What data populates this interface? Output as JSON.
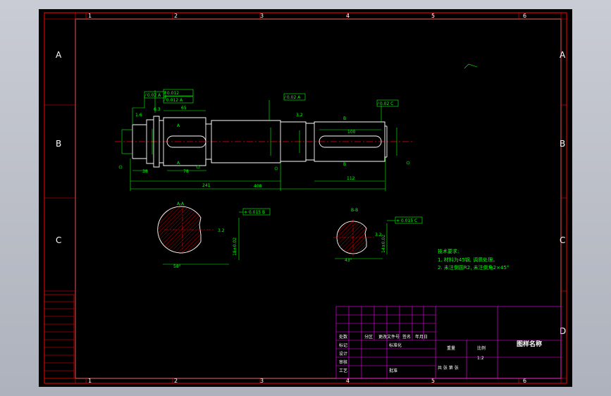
{
  "colors": {
    "background": "#000000",
    "frame": "#ff0000",
    "outline": "#ffffff",
    "dimension": "#00ff00",
    "centerline": "#ff0000",
    "table": "#ff00ff",
    "viewport": "#b8bcc6"
  },
  "zones": {
    "columns": [
      "1",
      "2",
      "3",
      "4",
      "5",
      "6"
    ],
    "rows": [
      "A",
      "B",
      "C",
      "D"
    ]
  },
  "drawing": {
    "gdt_frames": [
      "⁄ 0.02 A",
      "⁄⁄ 0.012",
      "⁄ 0.012 A",
      "⁄ 0.02 A",
      "⁄ 0.02 C",
      "≑ 0.015 B",
      "≑ 0.015 C"
    ],
    "dimensions": [
      "65",
      "241",
      "408",
      "78",
      "38",
      "100",
      "112",
      "1.6",
      "3.2",
      "6.3"
    ],
    "section_labels": {
      "a_top": "A",
      "a_bottom": "A",
      "b_top": "B",
      "b_bottom": "B",
      "aa": "A-A",
      "bb": "B-B"
    },
    "section_dims": {
      "aa_width": "58°",
      "aa_depth": "18±0.02",
      "aa_bottom": "58",
      "bb_width": "43°",
      "bb_depth": "14±0.02",
      "bb_bottom": "43"
    },
    "roughness_note": "3.2"
  },
  "tech_req": {
    "title": "技术要求:",
    "items": [
      "1. 材料为45钢, 调质处理。",
      "2. 未注倒圆R2, 未注倒角2×45°"
    ]
  },
  "title_block": {
    "name": "图样名称",
    "ratio_label": "比例",
    "ratio_value": "1:2",
    "weight_label": "重量",
    "sheet_label": "共 张 第 张",
    "row_labels": [
      "标记",
      "设计",
      "审核",
      "工艺"
    ],
    "header_cells": [
      "处数",
      "分区",
      "更改文件号",
      "签名",
      "年月日"
    ],
    "std_label": "标准化",
    "approve_label": "批准"
  }
}
